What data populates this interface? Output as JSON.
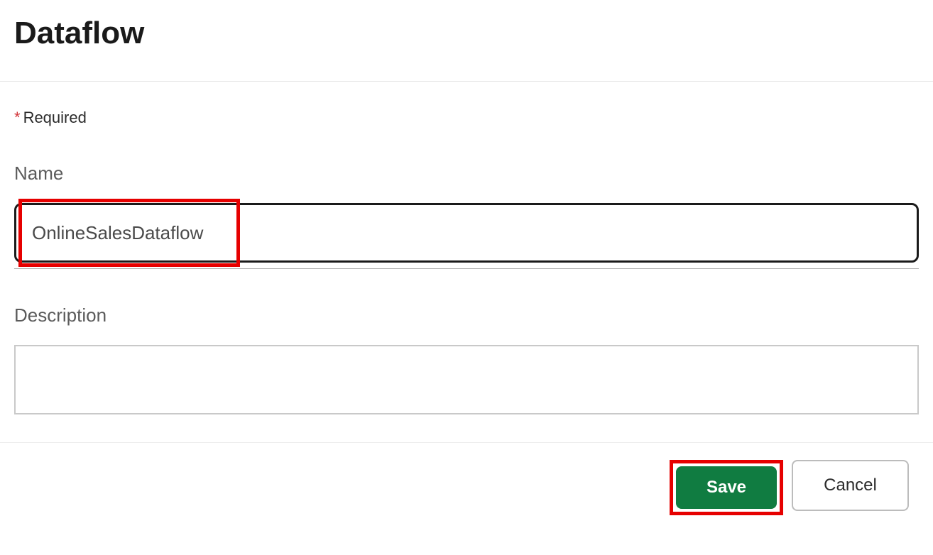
{
  "dialog": {
    "title": "Dataflow",
    "required_label": "Required",
    "required_mark": "*"
  },
  "fields": {
    "name": {
      "label": "Name",
      "value": "OnlineSalesDataflow"
    },
    "description": {
      "label": "Description",
      "value": ""
    }
  },
  "buttons": {
    "save": "Save",
    "cancel": "Cancel"
  },
  "colors": {
    "primary": "#107c41",
    "highlight": "#e60000"
  }
}
